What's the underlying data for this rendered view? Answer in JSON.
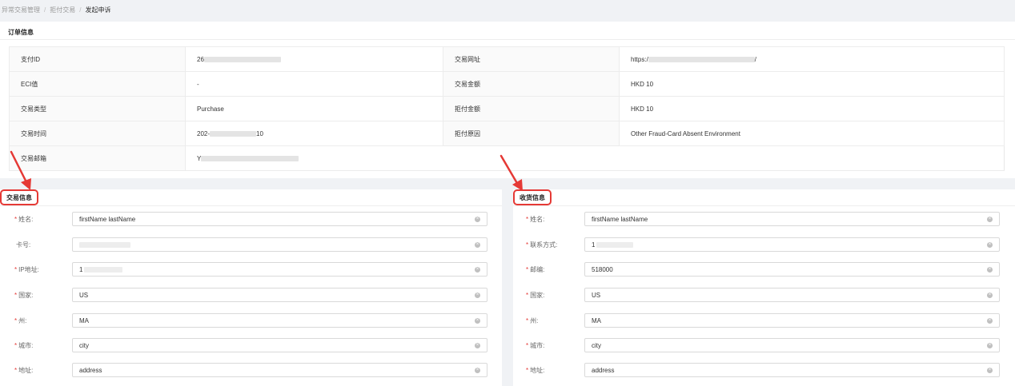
{
  "breadcrumb": {
    "items": [
      "异常交易管理",
      "拒付交易",
      "发起申诉"
    ]
  },
  "order": {
    "title": "订单信息",
    "rows": [
      {
        "label1": "支付ID",
        "value1": "26",
        "label2": "交易网址",
        "value2": "https:/",
        "value2_suffix": "/"
      },
      {
        "label1": "ECI值",
        "value1": "-",
        "label2": "交易金额",
        "value2": "HKD 10"
      },
      {
        "label1": "交易类型",
        "value1": "Purchase",
        "label2": "拒付金额",
        "value2": "HKD 10"
      },
      {
        "label1": "交易时间",
        "value1": "202-",
        "value1_suffix": "10",
        "label2": "拒付原因",
        "value2": "Other Fraud-Card Absent Environment"
      },
      {
        "label1": "交易邮箱",
        "value1": "Y"
      }
    ]
  },
  "transaction": {
    "title": "交易信息",
    "fields": [
      {
        "label": "姓名:",
        "required": "*",
        "value": "firstName lastName"
      },
      {
        "label": "卡号:",
        "required": "",
        "value": ""
      },
      {
        "label": "IP地址:",
        "required": "*",
        "value": "1"
      },
      {
        "label": "国家:",
        "required": "*",
        "value": "US"
      },
      {
        "label": "州:",
        "required": "*",
        "value": "MA"
      },
      {
        "label": "城市:",
        "required": "*",
        "value": "city"
      },
      {
        "label": "地址:",
        "required": "*",
        "value": "address"
      }
    ]
  },
  "shipping": {
    "title": "收货信息",
    "fields": [
      {
        "label": "姓名:",
        "required": "*",
        "value": "firstName lastName"
      },
      {
        "label": "联系方式:",
        "required": "*",
        "value": "1"
      },
      {
        "label": "邮编:",
        "required": "*",
        "value": "518000"
      },
      {
        "label": "国家:",
        "required": "*",
        "value": "US"
      },
      {
        "label": "州:",
        "required": "*",
        "value": "MA"
      },
      {
        "label": "城市:",
        "required": "*",
        "value": "city"
      },
      {
        "label": "地址:",
        "required": "*",
        "value": "address"
      }
    ]
  },
  "colors": {
    "required": "#e53935",
    "highlight": "#e53935",
    "background": "#f0f2f5"
  },
  "icons": {
    "clear": "clear-circle-icon",
    "annotation": "red-arrow-icon"
  }
}
